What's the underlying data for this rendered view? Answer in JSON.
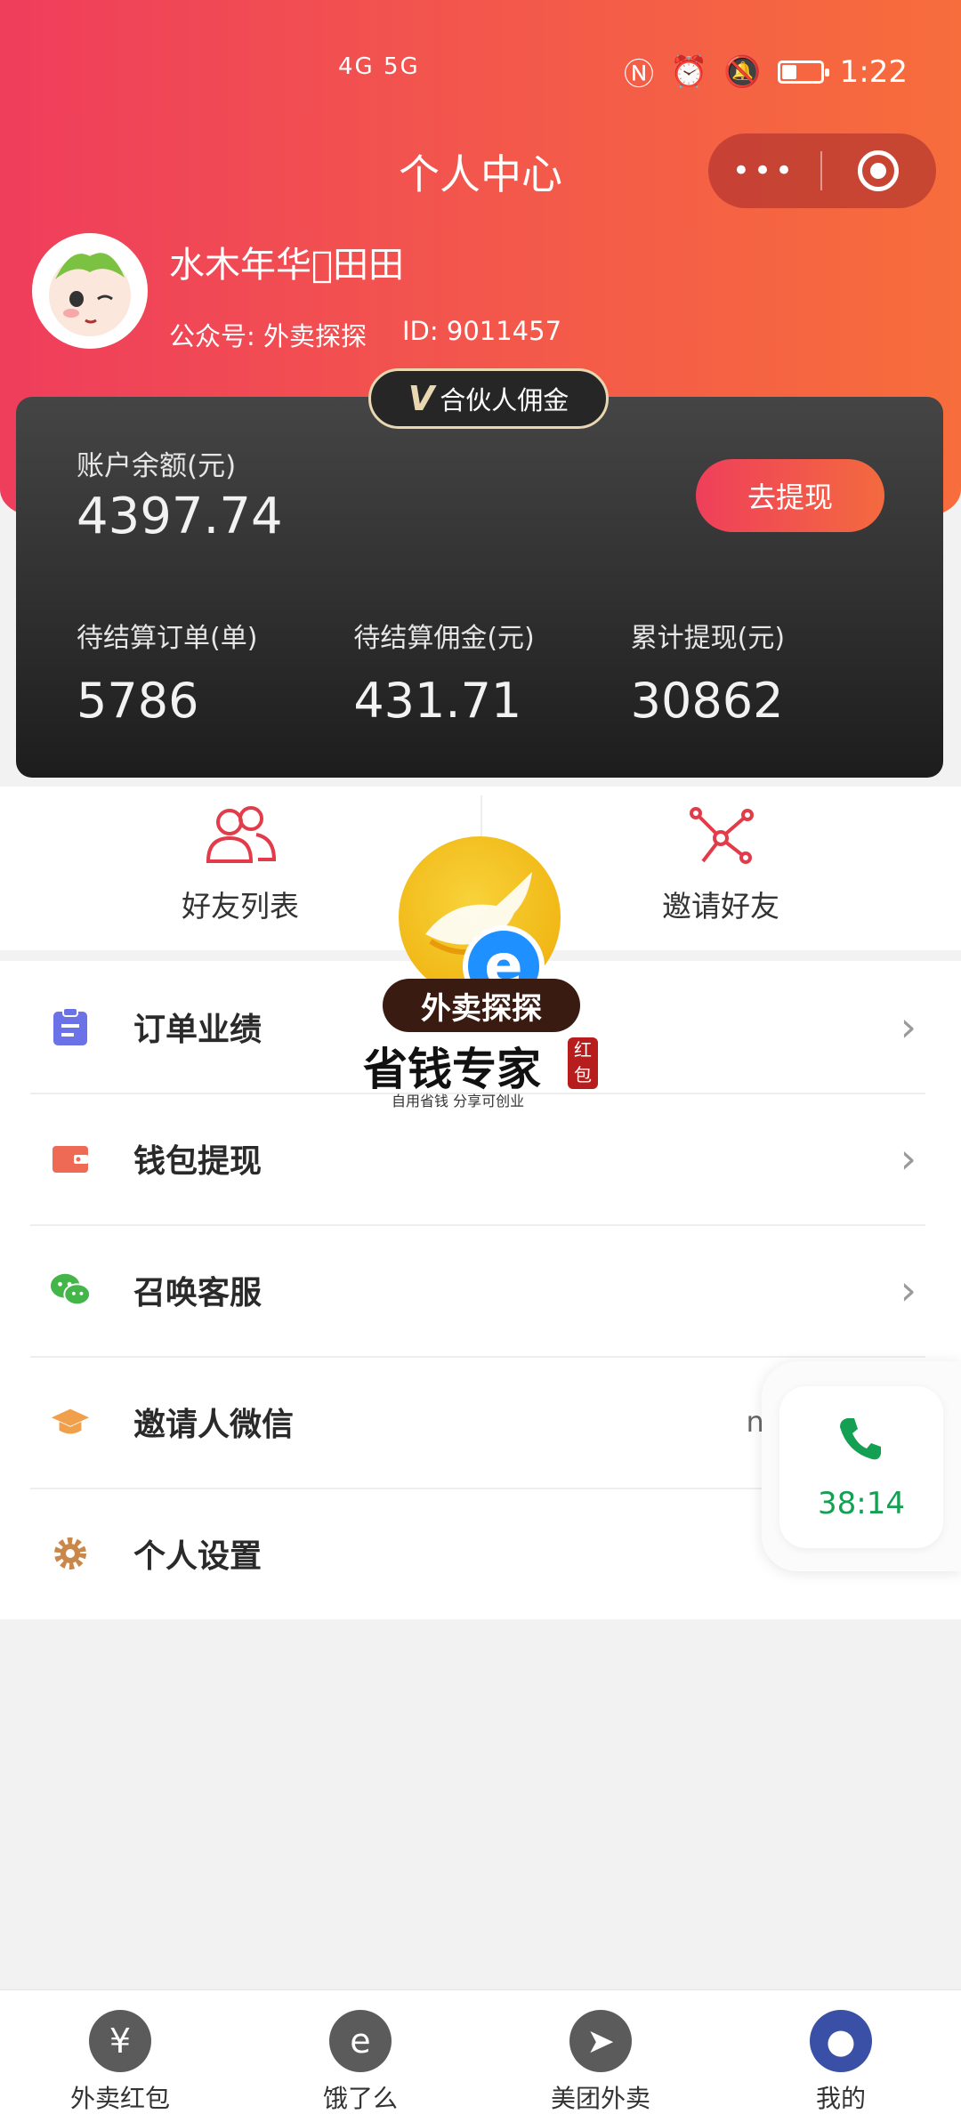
{
  "status_bar": {
    "signal_text": "4G 5G",
    "time": "1:22"
  },
  "page": {
    "title": "个人中心"
  },
  "user": {
    "name": "水木年华\u0000田田",
    "public_account": "公众号: 外卖探探",
    "id": "ID: 9011457"
  },
  "vip_badge": {
    "mark": "V",
    "label": "合伙人佣金"
  },
  "account": {
    "balance_label": "账户余额(元)",
    "balance_value": "4397.74",
    "withdraw_button": "去提现",
    "stats": [
      {
        "label": "待结算订单(单)",
        "value": "5786"
      },
      {
        "label": "待结算佣金(元)",
        "value": "431.71"
      },
      {
        "label": "累计提现(元)",
        "value": "30862"
      }
    ]
  },
  "quick_actions": [
    {
      "label": "好友列表",
      "icon": "users-icon"
    },
    {
      "label": "邀请好友",
      "icon": "share-nodes-icon"
    }
  ],
  "overlay_logo": {
    "banner": "外卖探探",
    "subtitle": "省钱专家",
    "seal": "红包",
    "tagline": "自用省钱  分享可创业"
  },
  "menu": [
    {
      "label": "订单业绩",
      "icon": "clipboard-icon",
      "color": "#6b72e8",
      "value": ""
    },
    {
      "label": "钱包提现",
      "icon": "wallet-icon",
      "color": "#ee6a55",
      "value": ""
    },
    {
      "label": "召唤客服",
      "icon": "wechat-icon",
      "color": "#44b549",
      "value": ""
    },
    {
      "label": "邀请人微信",
      "icon": "graduation-cap-icon",
      "color": "#f0a04a",
      "value": "nf"
    },
    {
      "label": "个人设置",
      "icon": "gear-icon",
      "color": "#c9874a",
      "value": ""
    }
  ],
  "call_float": {
    "time": "38:14",
    "color": "#14a052"
  },
  "tabbar": [
    {
      "label": "外卖红包",
      "icon": "red-packet-icon",
      "glyph": "¥",
      "active": false
    },
    {
      "label": "饿了么",
      "icon": "eleme-icon",
      "glyph": "e",
      "active": false
    },
    {
      "label": "美团外卖",
      "icon": "kangaroo-icon",
      "glyph": "➤",
      "active": false
    },
    {
      "label": "我的",
      "icon": "user-icon",
      "glyph": "●",
      "active": true
    }
  ],
  "colors": {
    "header_start": "#ef3d5c",
    "header_end": "#f76d3c",
    "active_tab": "#3a4fa6"
  }
}
